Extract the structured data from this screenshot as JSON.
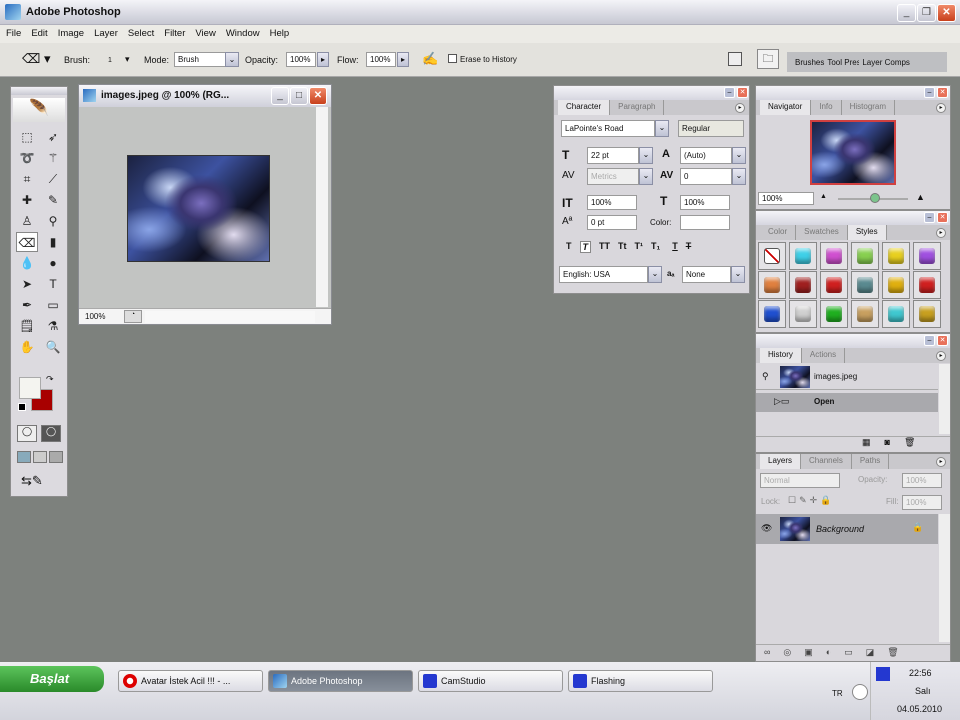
{
  "app": {
    "title": "Adobe Photoshop"
  },
  "menu": [
    "File",
    "Edit",
    "Image",
    "Layer",
    "Select",
    "Filter",
    "View",
    "Window",
    "Help"
  ],
  "options": {
    "brush_label": "Brush:",
    "brush_size": "1",
    "mode_label": "Mode:",
    "mode_value": "Brush",
    "opacity_label": "Opacity:",
    "opacity_value": "100%",
    "flow_label": "Flow:",
    "flow_value": "100%",
    "erase_to_history": "Erase to History",
    "erase_to_history_checked": false
  },
  "palette_well": {
    "tabs": [
      "Brushes",
      "Tool Presets",
      "Layer Comps"
    ]
  },
  "document": {
    "title": "images.jpeg @ 100% (RG...",
    "zoom": "100%"
  },
  "toolbox": {
    "foreground": "#f4f4f0",
    "background": "#a80000"
  },
  "character": {
    "tabs": [
      "Character",
      "Paragraph"
    ],
    "font_family": "LaPointe's Road",
    "font_style": "Regular",
    "font_size": "22 pt",
    "leading": "(Auto)",
    "kerning": "Metrics",
    "tracking": "0",
    "vertical_scale": "100%",
    "horizontal_scale": "100%",
    "baseline_shift": "0 pt",
    "color_label": "Color:",
    "style_buttons": [
      "T",
      "T",
      "TT",
      "Tt",
      "T¹",
      "T₁",
      "T",
      "T"
    ],
    "language": "English: USA",
    "aa_label": "aₐ",
    "antialias": "None"
  },
  "navigator": {
    "tabs": [
      "Navigator",
      "Info",
      "Histogram"
    ],
    "zoom": "100%"
  },
  "styles": {
    "tabs": [
      "Color",
      "Swatches",
      "Styles"
    ],
    "swatches": [
      "none",
      "#3fd0e8",
      "#d050d0",
      "#88d050",
      "#e8d020",
      "#a050e0",
      "#e08040",
      "#a02020",
      "#d02020",
      "#5a8a90",
      "#e0b010",
      "#d02020",
      "#2050d0",
      "#d0d0d0",
      "#20b020",
      "#c8a060",
      "#40c8d0",
      "#c8a020"
    ]
  },
  "history": {
    "tabs": [
      "History",
      "Actions"
    ],
    "snapshot": "images.jpeg",
    "steps": [
      "Open"
    ]
  },
  "layers": {
    "tabs": [
      "Layers",
      "Channels",
      "Paths"
    ],
    "blend_mode": "Normal",
    "opacity_label": "Opacity:",
    "opacity": "100%",
    "lock_label": "Lock:",
    "fill_label": "Fill:",
    "fill": "100%",
    "items": [
      {
        "name": "Background",
        "visible": true,
        "locked": true
      }
    ]
  },
  "taskbar": {
    "start": "Başlat",
    "tasks": [
      "Avatar İstek Acil !!! - ...",
      "Adobe Photoshop",
      "CamStudio",
      "Flashing"
    ],
    "lang": "TR",
    "time": "22:56",
    "day": "Salı",
    "date": "04.05.2010"
  }
}
